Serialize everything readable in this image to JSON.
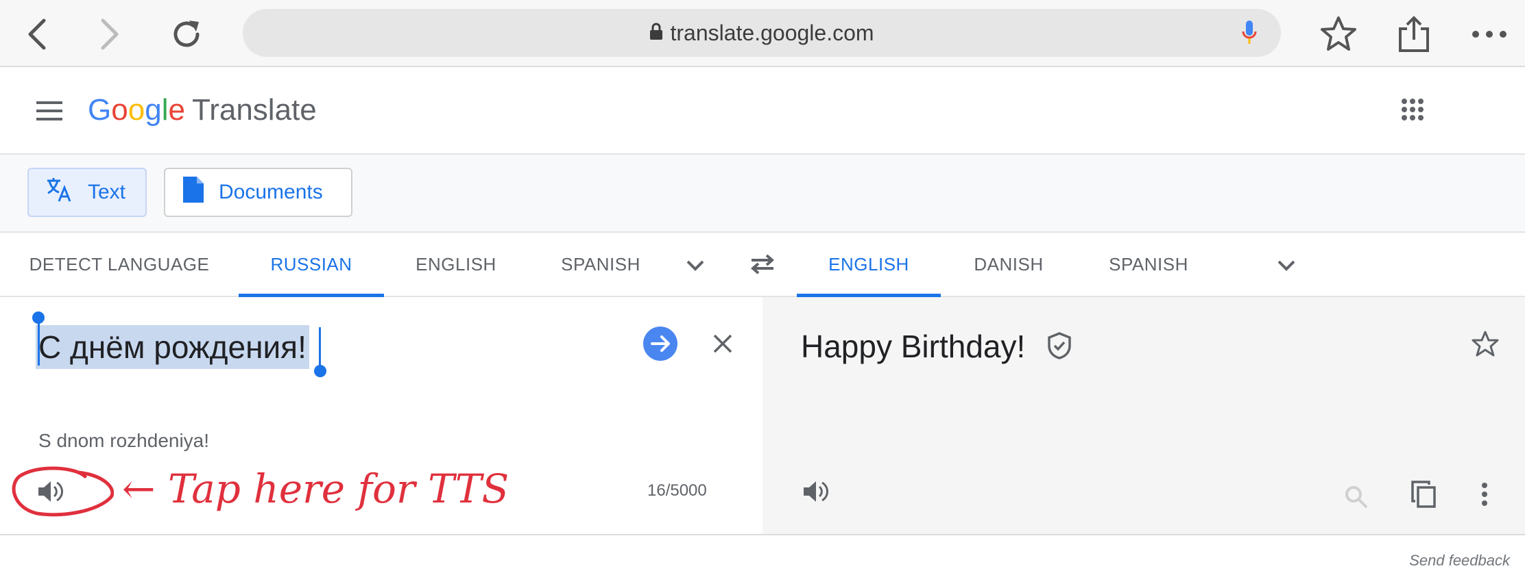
{
  "browser": {
    "url": "translate.google.com",
    "icons": [
      "back-icon",
      "forward-icon",
      "reload-icon",
      "lock-icon",
      "mic-icon",
      "bookmark-star-icon",
      "share-icon",
      "more-icon"
    ]
  },
  "header": {
    "logo_letters": [
      "G",
      "o",
      "o",
      "g",
      "l",
      "e"
    ],
    "product": "Translate"
  },
  "modes": {
    "text_label": "Text",
    "documents_label": "Documents"
  },
  "source_tabs": [
    "DETECT LANGUAGE",
    "RUSSIAN",
    "ENGLISH",
    "SPANISH"
  ],
  "target_tabs": [
    "ENGLISH",
    "DANISH",
    "SPANISH"
  ],
  "source": {
    "text": "С днём рождения!",
    "transliteration": "S dnom rozhdeniya!",
    "char_count": "16/5000"
  },
  "target": {
    "text": "Happy Birthday!"
  },
  "annotation": "← Tap here for TTS",
  "footer": {
    "send_feedback": "Send feedback"
  },
  "colors": {
    "accent": "#1a73e8",
    "annotation": "#e0303d",
    "selection": "#c8d8ef"
  }
}
